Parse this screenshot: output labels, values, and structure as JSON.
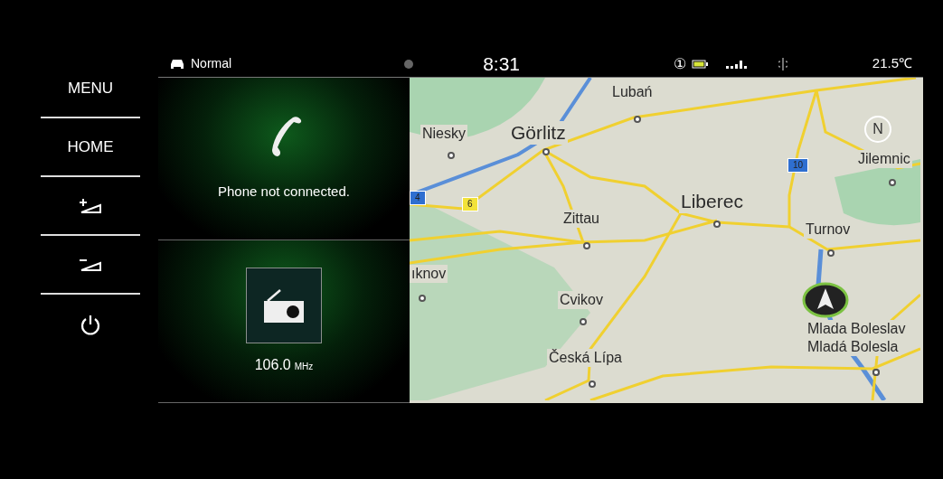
{
  "status_bar": {
    "drive_mode": "Normal",
    "time": "8:31",
    "indicator": "①",
    "temperature": "21.5℃"
  },
  "sidebar": {
    "items": [
      {
        "kind": "text",
        "label": "MENU"
      },
      {
        "kind": "text",
        "label": "HOME"
      },
      {
        "kind": "volume-up"
      },
      {
        "kind": "volume-down"
      },
      {
        "kind": "power"
      }
    ]
  },
  "tiles": [
    {
      "kind": "phone",
      "message": "Phone not connected."
    },
    {
      "kind": "radio",
      "frequency": "106.0",
      "unit": "MHz"
    }
  ],
  "map": {
    "labels": [
      {
        "kind": "town",
        "text": "Lubań"
      },
      {
        "kind": "town",
        "text": "Niesky"
      },
      {
        "kind": "city",
        "text": "Görlitz"
      },
      {
        "kind": "town",
        "text": "Jilemnic"
      },
      {
        "kind": "city",
        "text": "Liberec"
      },
      {
        "kind": "town",
        "text": "Zittau"
      },
      {
        "kind": "town",
        "text": "Turnov"
      },
      {
        "kind": "town",
        "text": "ıknov"
      },
      {
        "kind": "town",
        "text": "Cvikov"
      },
      {
        "kind": "town",
        "text": "Česká Lípa"
      },
      {
        "kind": "town",
        "text": "Mlada Boleslav"
      },
      {
        "kind": "town",
        "text": "Mladá Bolesla"
      }
    ],
    "shields": [
      {
        "text": "4",
        "color": "#2f6fd0"
      },
      {
        "text": "6",
        "color": "#f2e23a"
      },
      {
        "text": "10",
        "color": "#2f6fd0"
      }
    ],
    "compass": "N"
  }
}
